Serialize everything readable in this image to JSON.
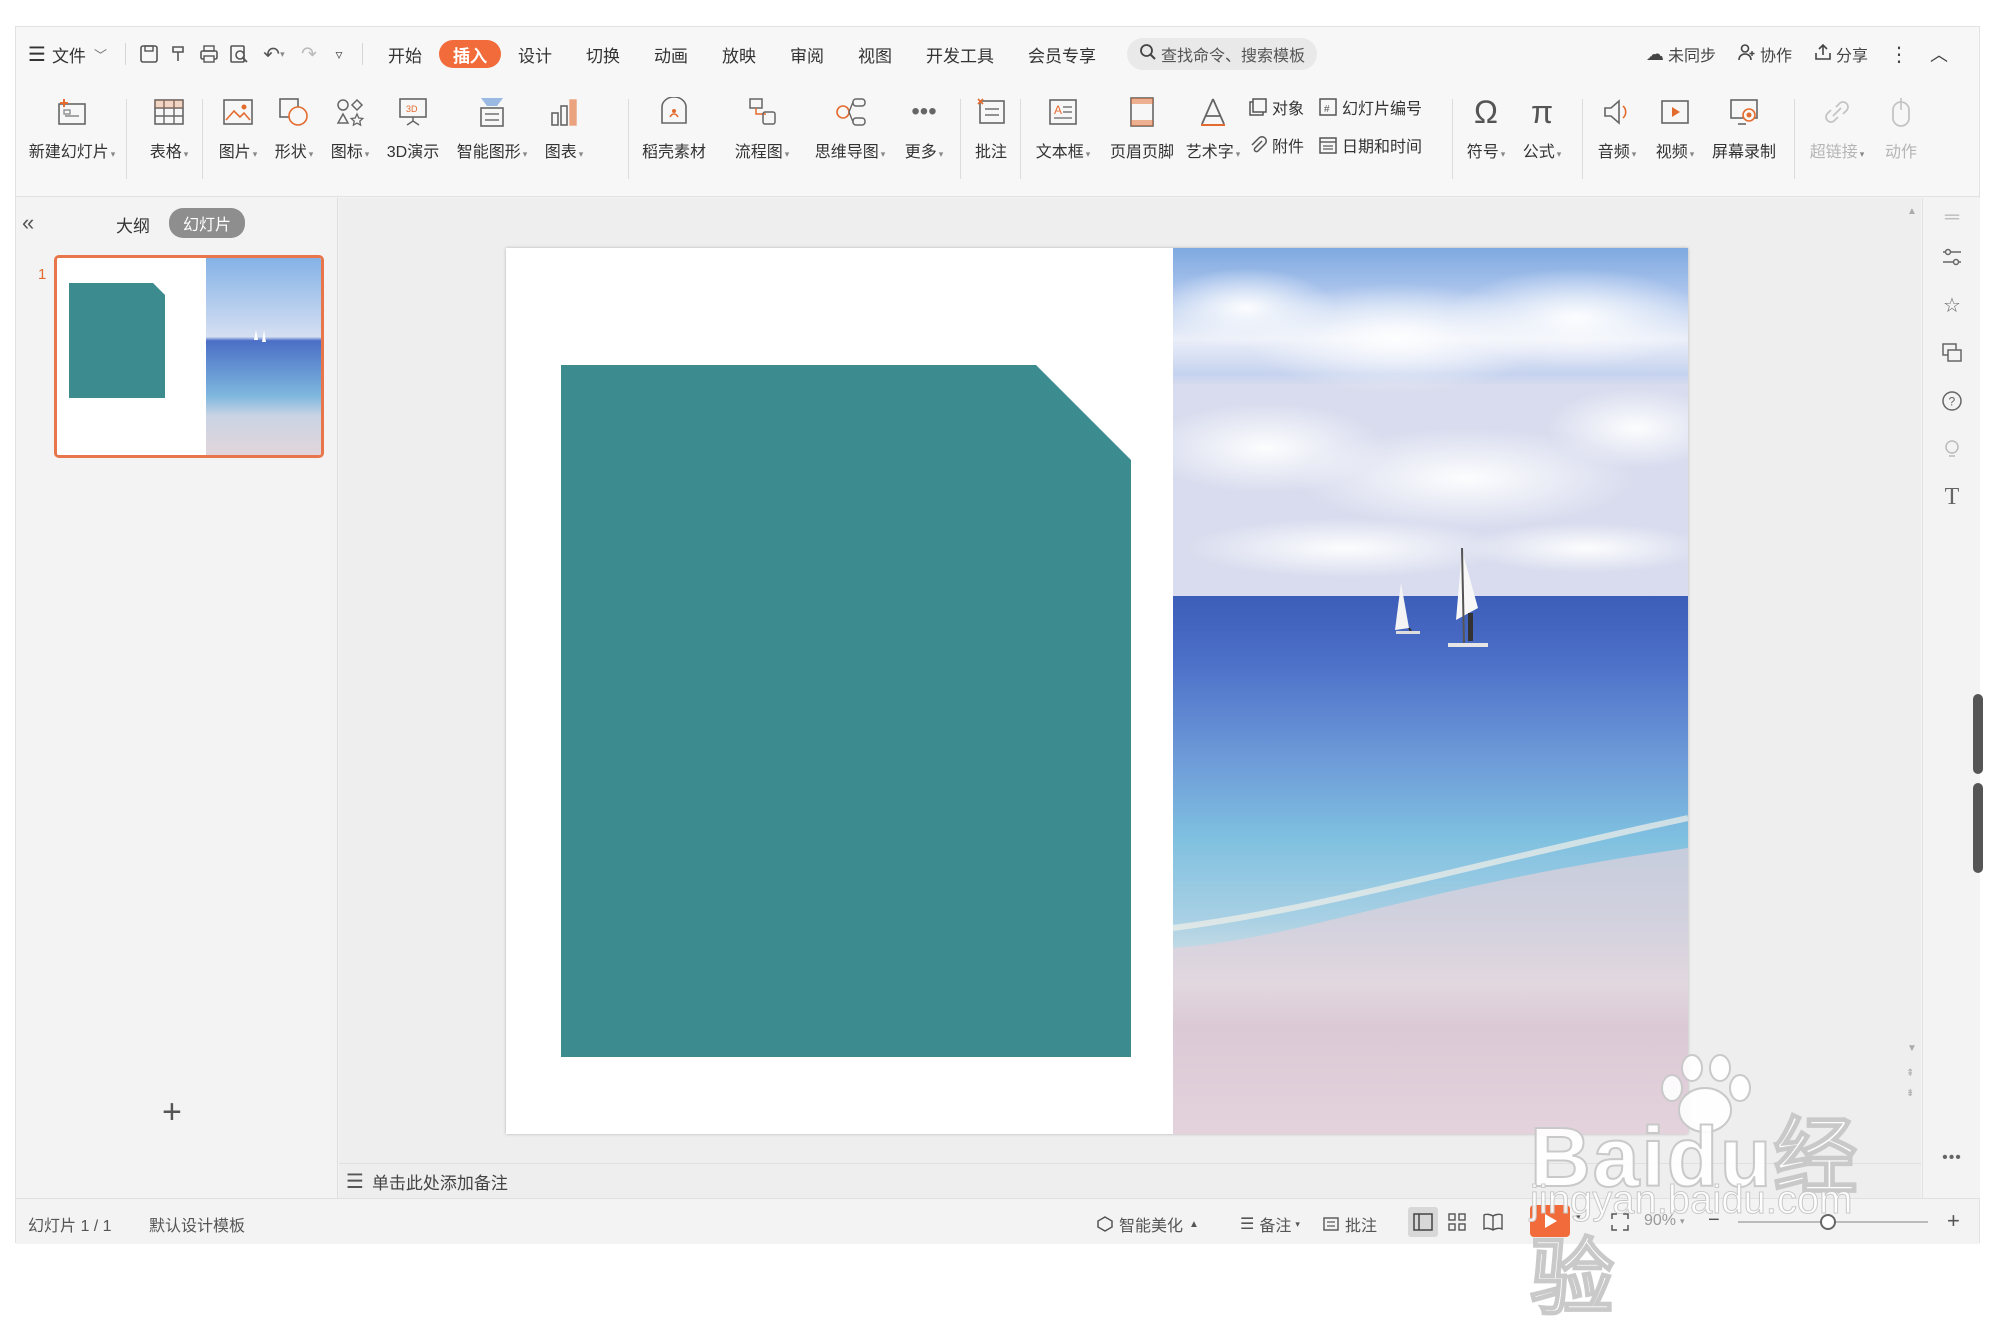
{
  "menubar": {
    "file_label": "文件",
    "tabs": [
      "开始",
      "插入",
      "设计",
      "切换",
      "动画",
      "放映",
      "审阅",
      "视图",
      "开发工具",
      "会员专享"
    ],
    "active_tab": "插入",
    "search_placeholder": "查找命令、搜索模板",
    "sync_label": "未同步",
    "collab_label": "协作",
    "share_label": "分享"
  },
  "ribbon": {
    "new_slide": "新建幻灯片",
    "table": "表格",
    "picture": "图片",
    "shape": "形状",
    "icon": "图标",
    "demo3d": "3D演示",
    "smartart": "智能图形",
    "chart": "图表",
    "materials": "稻壳素材",
    "flowchart": "流程图",
    "mindmap": "思维导图",
    "more": "更多",
    "comment": "批注",
    "textbox": "文本框",
    "header_footer": "页眉页脚",
    "wordart": "艺术字",
    "object": "对象",
    "attachment": "附件",
    "slide_number": "幻灯片编号",
    "datetime": "日期和时间",
    "symbol": "符号",
    "formula": "公式",
    "audio": "音频",
    "video": "视频",
    "screen_record": "屏幕录制",
    "hyperlink": "超链接",
    "action": "动作"
  },
  "left_panel": {
    "tab_outline": "大纲",
    "tab_slides": "幻灯片",
    "slide_number": "1"
  },
  "notes": {
    "placeholder": "单击此处添加备注"
  },
  "status": {
    "slide_counter": "幻灯片 1 / 1",
    "template": "默认设计模板",
    "beautify": "智能美化",
    "notes": "备注",
    "comments": "批注",
    "zoom": "90%"
  },
  "watermark": {
    "line1": "Baidu经验",
    "line2": "jingyan.baidu.com"
  },
  "colors": {
    "accent": "#f26b3a",
    "teal_shape": "#3b8b8f",
    "selection": "#e8764a"
  }
}
